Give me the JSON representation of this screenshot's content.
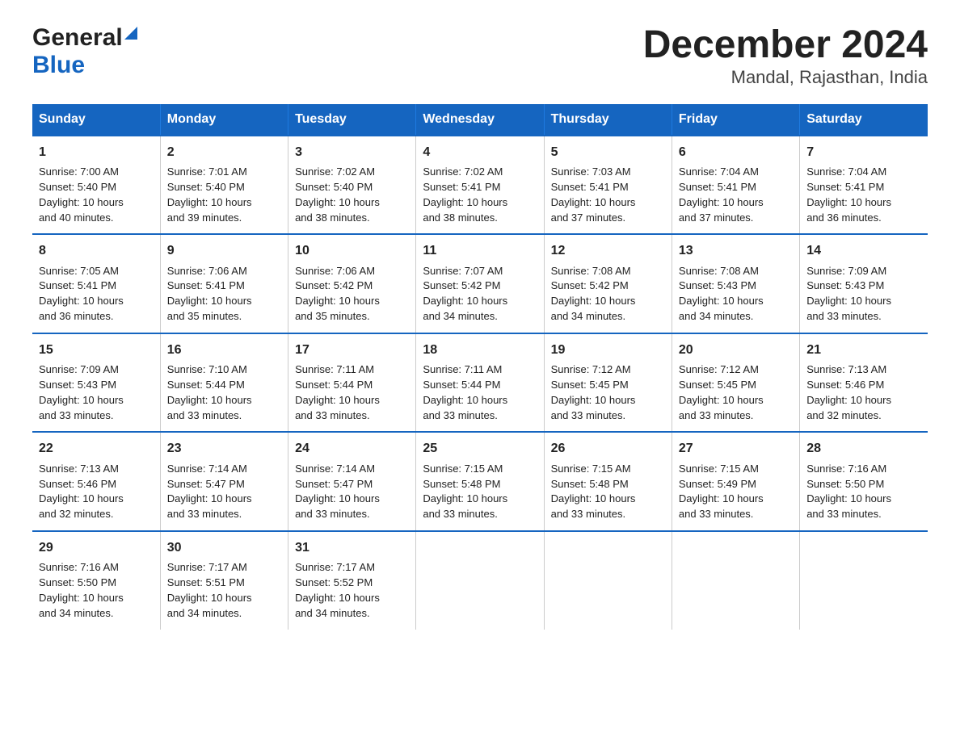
{
  "header": {
    "logo_general": "General",
    "logo_blue": "Blue",
    "title": "December 2024",
    "subtitle": "Mandal, Rajasthan, India"
  },
  "days_of_week": [
    "Sunday",
    "Monday",
    "Tuesday",
    "Wednesday",
    "Thursday",
    "Friday",
    "Saturday"
  ],
  "weeks": [
    [
      {
        "day": "1",
        "sunrise": "7:00 AM",
        "sunset": "5:40 PM",
        "daylight": "10 hours and 40 minutes."
      },
      {
        "day": "2",
        "sunrise": "7:01 AM",
        "sunset": "5:40 PM",
        "daylight": "10 hours and 39 minutes."
      },
      {
        "day": "3",
        "sunrise": "7:02 AM",
        "sunset": "5:40 PM",
        "daylight": "10 hours and 38 minutes."
      },
      {
        "day": "4",
        "sunrise": "7:02 AM",
        "sunset": "5:41 PM",
        "daylight": "10 hours and 38 minutes."
      },
      {
        "day": "5",
        "sunrise": "7:03 AM",
        "sunset": "5:41 PM",
        "daylight": "10 hours and 37 minutes."
      },
      {
        "day": "6",
        "sunrise": "7:04 AM",
        "sunset": "5:41 PM",
        "daylight": "10 hours and 37 minutes."
      },
      {
        "day": "7",
        "sunrise": "7:04 AM",
        "sunset": "5:41 PM",
        "daylight": "10 hours and 36 minutes."
      }
    ],
    [
      {
        "day": "8",
        "sunrise": "7:05 AM",
        "sunset": "5:41 PM",
        "daylight": "10 hours and 36 minutes."
      },
      {
        "day": "9",
        "sunrise": "7:06 AM",
        "sunset": "5:41 PM",
        "daylight": "10 hours and 35 minutes."
      },
      {
        "day": "10",
        "sunrise": "7:06 AM",
        "sunset": "5:42 PM",
        "daylight": "10 hours and 35 minutes."
      },
      {
        "day": "11",
        "sunrise": "7:07 AM",
        "sunset": "5:42 PM",
        "daylight": "10 hours and 34 minutes."
      },
      {
        "day": "12",
        "sunrise": "7:08 AM",
        "sunset": "5:42 PM",
        "daylight": "10 hours and 34 minutes."
      },
      {
        "day": "13",
        "sunrise": "7:08 AM",
        "sunset": "5:43 PM",
        "daylight": "10 hours and 34 minutes."
      },
      {
        "day": "14",
        "sunrise": "7:09 AM",
        "sunset": "5:43 PM",
        "daylight": "10 hours and 33 minutes."
      }
    ],
    [
      {
        "day": "15",
        "sunrise": "7:09 AM",
        "sunset": "5:43 PM",
        "daylight": "10 hours and 33 minutes."
      },
      {
        "day": "16",
        "sunrise": "7:10 AM",
        "sunset": "5:44 PM",
        "daylight": "10 hours and 33 minutes."
      },
      {
        "day": "17",
        "sunrise": "7:11 AM",
        "sunset": "5:44 PM",
        "daylight": "10 hours and 33 minutes."
      },
      {
        "day": "18",
        "sunrise": "7:11 AM",
        "sunset": "5:44 PM",
        "daylight": "10 hours and 33 minutes."
      },
      {
        "day": "19",
        "sunrise": "7:12 AM",
        "sunset": "5:45 PM",
        "daylight": "10 hours and 33 minutes."
      },
      {
        "day": "20",
        "sunrise": "7:12 AM",
        "sunset": "5:45 PM",
        "daylight": "10 hours and 33 minutes."
      },
      {
        "day": "21",
        "sunrise": "7:13 AM",
        "sunset": "5:46 PM",
        "daylight": "10 hours and 32 minutes."
      }
    ],
    [
      {
        "day": "22",
        "sunrise": "7:13 AM",
        "sunset": "5:46 PM",
        "daylight": "10 hours and 32 minutes."
      },
      {
        "day": "23",
        "sunrise": "7:14 AM",
        "sunset": "5:47 PM",
        "daylight": "10 hours and 33 minutes."
      },
      {
        "day": "24",
        "sunrise": "7:14 AM",
        "sunset": "5:47 PM",
        "daylight": "10 hours and 33 minutes."
      },
      {
        "day": "25",
        "sunrise": "7:15 AM",
        "sunset": "5:48 PM",
        "daylight": "10 hours and 33 minutes."
      },
      {
        "day": "26",
        "sunrise": "7:15 AM",
        "sunset": "5:48 PM",
        "daylight": "10 hours and 33 minutes."
      },
      {
        "day": "27",
        "sunrise": "7:15 AM",
        "sunset": "5:49 PM",
        "daylight": "10 hours and 33 minutes."
      },
      {
        "day": "28",
        "sunrise": "7:16 AM",
        "sunset": "5:50 PM",
        "daylight": "10 hours and 33 minutes."
      }
    ],
    [
      {
        "day": "29",
        "sunrise": "7:16 AM",
        "sunset": "5:50 PM",
        "daylight": "10 hours and 34 minutes."
      },
      {
        "day": "30",
        "sunrise": "7:17 AM",
        "sunset": "5:51 PM",
        "daylight": "10 hours and 34 minutes."
      },
      {
        "day": "31",
        "sunrise": "7:17 AM",
        "sunset": "5:52 PM",
        "daylight": "10 hours and 34 minutes."
      },
      null,
      null,
      null,
      null
    ]
  ],
  "labels": {
    "sunrise": "Sunrise:",
    "sunset": "Sunset:",
    "daylight": "Daylight:"
  }
}
